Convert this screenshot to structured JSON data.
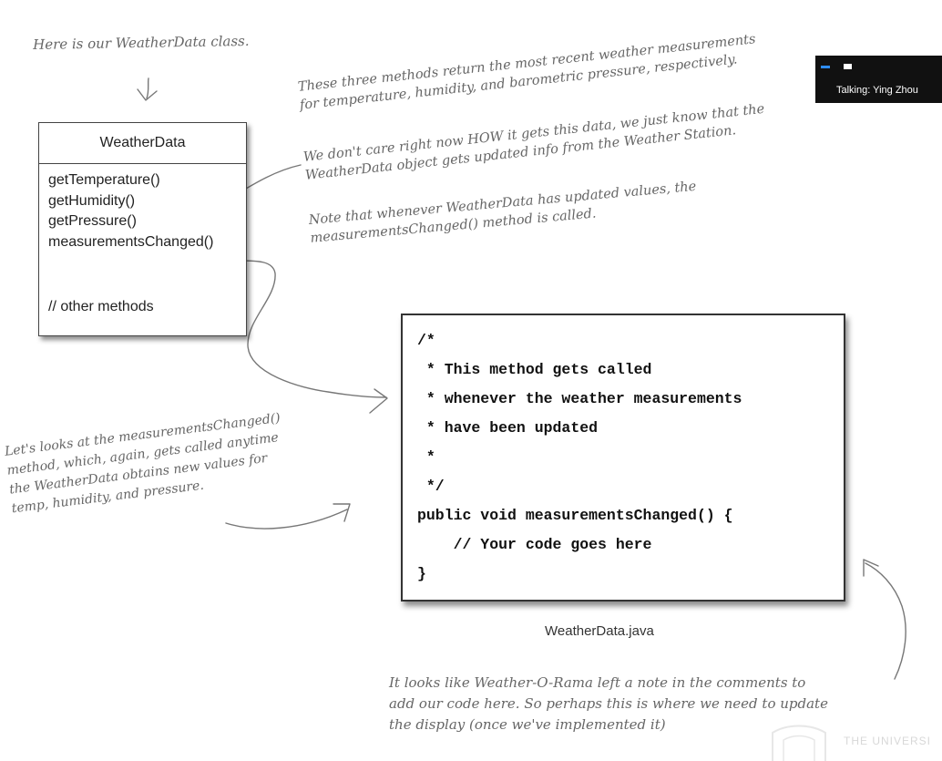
{
  "top_note": "Here is our WeatherData class.",
  "uml": {
    "class_name": "WeatherData",
    "methods": [
      "getTemperature()",
      "getHumidity()",
      "getPressure()",
      "measurementsChanged()"
    ],
    "other": "// other methods"
  },
  "right_notes": {
    "returns_line1": "These three methods return the most recent weather measurements",
    "returns_line2": "for temperature, humidity, and barometric pressure, respectively.",
    "care_line1": "We don't care right now HOW it gets this data, we just know that the",
    "care_line2": "WeatherData object gets updated info from the Weather Station.",
    "note_line1": "Note that whenever WeatherData has updated values, the",
    "note_line2": "measurementsChanged() method is called."
  },
  "left_note": [
    "Let's looks at the measurementsChanged()",
    "method, which, again, gets called anytime",
    "the WeatherData obtains new values for",
    "temp, humidity, and pressure."
  ],
  "code": {
    "lines": [
      "/*",
      " * This method gets called",
      " * whenever the weather measurements",
      " * have been updated",
      " *",
      " */",
      "public void measurementsChanged() {",
      "    // Your code goes here",
      "}"
    ],
    "filename": "WeatherData.java"
  },
  "bottom_note": [
    "It looks like Weather-O-Rama left a note in the comments to",
    "add our code here. So perhaps this is where we need to update",
    "the display (once we've implemented it)"
  ],
  "talking": {
    "label": "Talking: Ying Zhou",
    "dash_color": "#2e8dfc"
  },
  "watermark": "THE UNIVERSI"
}
